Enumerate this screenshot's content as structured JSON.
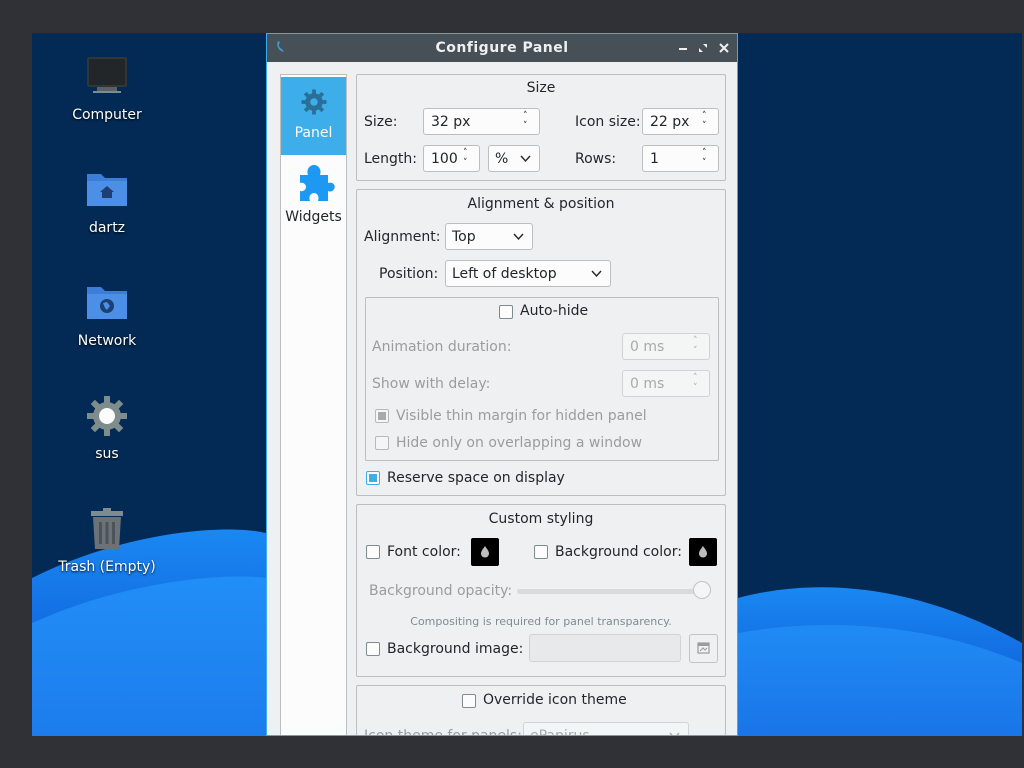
{
  "desktop": {
    "icons": [
      {
        "label": "Computer",
        "icon": "monitor-icon"
      },
      {
        "label": "dartz",
        "icon": "home-folder-icon"
      },
      {
        "label": "Network",
        "icon": "network-folder-icon"
      },
      {
        "label": "sus",
        "icon": "gear-icon"
      },
      {
        "label": "Trash (Empty)",
        "icon": "trash-icon"
      }
    ]
  },
  "window": {
    "title": "Configure Panel",
    "controls": [
      "minimize",
      "maximize",
      "close"
    ]
  },
  "sidebar": {
    "items": [
      {
        "label": "Panel",
        "icon": "gear-icon",
        "selected": true
      },
      {
        "label": "Widgets",
        "icon": "puzzle-icon",
        "selected": false
      }
    ]
  },
  "size_group": {
    "title": "Size",
    "size_label": "Size:",
    "size_value": "32 px",
    "icon_size_label": "Icon size:",
    "icon_size_value": "22 px",
    "length_label": "Length:",
    "length_value": "100",
    "length_unit": "%",
    "rows_label": "Rows:",
    "rows_value": "1"
  },
  "alignment_group": {
    "title": "Alignment & position",
    "alignment_label": "Alignment:",
    "alignment_value": "Top",
    "position_label": "Position:",
    "position_value": "Left of desktop",
    "autohide_label": "Auto-hide",
    "autohide_checked": false,
    "animation_label": "Animation duration:",
    "animation_value": "0 ms",
    "delay_label": "Show with delay:",
    "delay_value": "0 ms",
    "thin_margin_label": "Visible thin margin for hidden panel",
    "thin_margin_checked": true,
    "hide_overlap_label": "Hide only on overlapping a window",
    "hide_overlap_checked": false,
    "reserve_label": "Reserve space on display",
    "reserve_checked": true
  },
  "styling_group": {
    "title": "Custom styling",
    "font_color_label": "Font color:",
    "bg_color_label": "Background color:",
    "opacity_label": "Background opacity:",
    "opacity_value": 1.0,
    "compositing_note": "Compositing is required for panel transparency.",
    "bg_image_label": "Background image:"
  },
  "icon_theme_group": {
    "override_label": "Override icon theme",
    "theme_label": "Icon theme for panels:",
    "theme_value": "ePapirus"
  },
  "colors": {
    "accent": "#3daee9",
    "titlebar": "#475057",
    "window_bg": "#eff0f1",
    "desktop_bg": "#022a55"
  }
}
